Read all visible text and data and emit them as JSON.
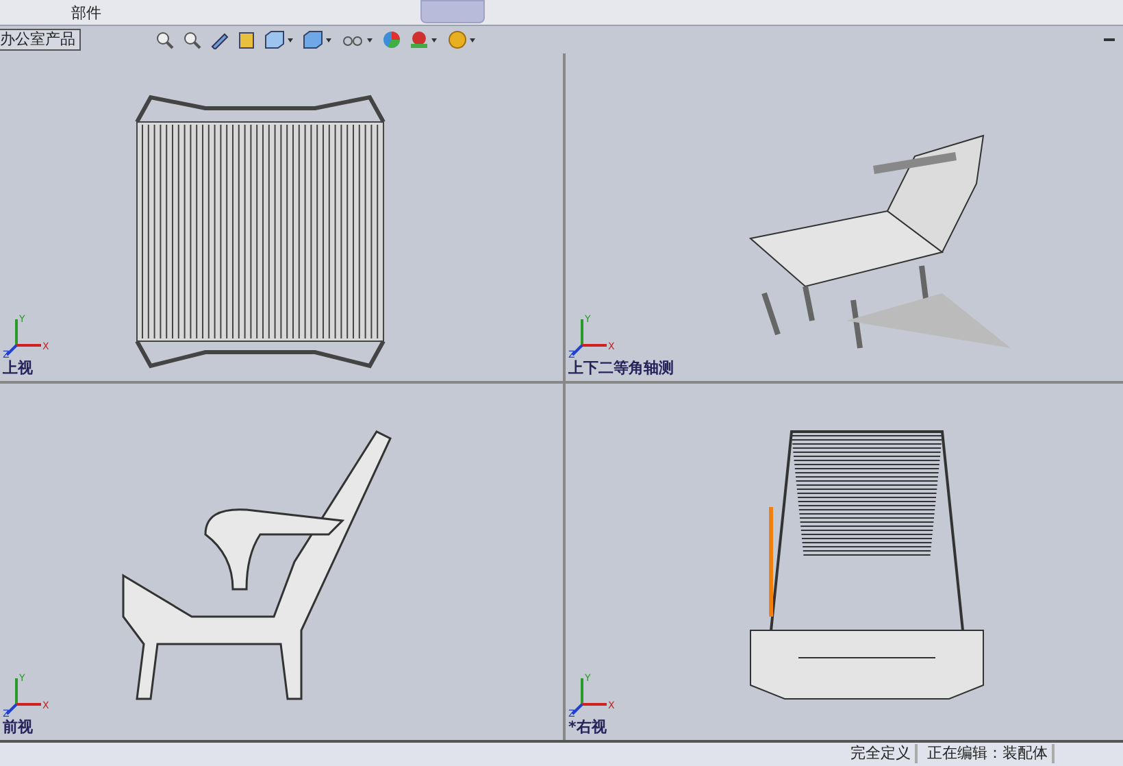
{
  "toolbar": {
    "label": "部件"
  },
  "tab": {
    "label": "办公室产品"
  },
  "viewports": [
    {
      "label": "上视",
      "kind": "top",
      "axes": {
        "x": "X",
        "y": "Y",
        "z": "Z"
      }
    },
    {
      "label": "上下二等角轴测",
      "kind": "iso",
      "axes": {
        "x": "X",
        "y": "Y",
        "z": "Z"
      }
    },
    {
      "label": "前视",
      "kind": "front",
      "axes": {
        "x": "X",
        "y": "Y",
        "z": "Z"
      }
    },
    {
      "label": "*右视",
      "kind": "right",
      "axes": {
        "x": "X",
        "y": "Y",
        "z": "Z"
      }
    }
  ],
  "status_bar": [
    "完全定义",
    "正在编辑：装配体"
  ]
}
